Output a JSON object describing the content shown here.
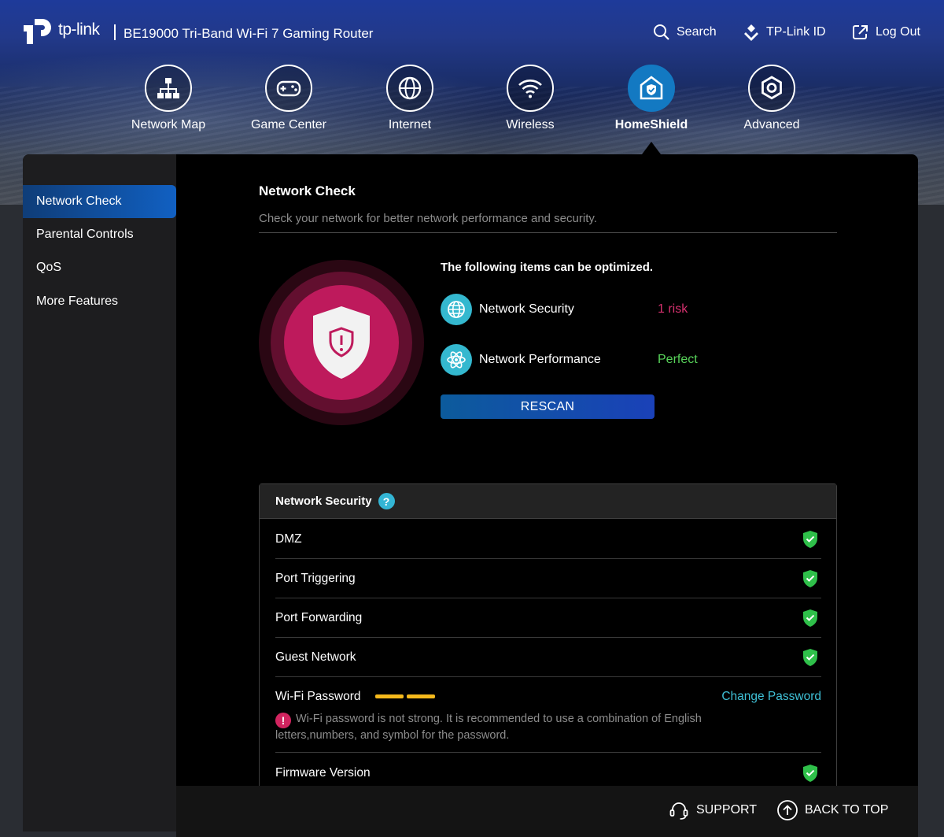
{
  "header": {
    "brand": "tp-link",
    "product": "BE19000 Tri-Band Wi-Fi 7 Gaming Router",
    "actions": {
      "search": "Search",
      "tplink_id": "TP-Link ID",
      "logout": "Log Out"
    }
  },
  "nav": {
    "items": [
      {
        "label": "Network Map",
        "icon": "network-map-icon"
      },
      {
        "label": "Game Center",
        "icon": "gamepad-icon"
      },
      {
        "label": "Internet",
        "icon": "globe-icon"
      },
      {
        "label": "Wireless",
        "icon": "wifi-icon"
      },
      {
        "label": "HomeShield",
        "icon": "homeshield-icon"
      },
      {
        "label": "Advanced",
        "icon": "gear-icon"
      }
    ],
    "active": "HomeShield"
  },
  "sidebar": {
    "items": [
      {
        "label": "Network Check"
      },
      {
        "label": "Parental Controls"
      },
      {
        "label": "QoS"
      },
      {
        "label": "More Features"
      }
    ],
    "active": "Network Check"
  },
  "main": {
    "title": "Network Check",
    "subtitle": "Check your network for better network performance and security.",
    "optimize_title": "The following items can be optimized.",
    "checks": [
      {
        "label": "Network Security",
        "status": "1 risk",
        "status_color": "#d6316f",
        "icon": "globe-icon"
      },
      {
        "label": "Network Performance",
        "status": "Perfect",
        "status_color": "#58d45a",
        "icon": "atom-icon"
      }
    ],
    "rescan_label": "RESCAN"
  },
  "security": {
    "title": "Network Security",
    "help": "?",
    "rows": [
      {
        "label": "DMZ",
        "state": "ok"
      },
      {
        "label": "Port Triggering",
        "state": "ok"
      },
      {
        "label": "Port Forwarding",
        "state": "ok"
      },
      {
        "label": "Guest Network",
        "state": "ok"
      }
    ],
    "wifi_password": {
      "label": "Wi-Fi Password",
      "strength_bars": 2,
      "action": "Change Password",
      "warning_icon": "!",
      "warning": "Wi-Fi password is not strong. It is recommended to use a combination of English letters,numbers, and symbol for the password."
    },
    "firmware": {
      "label": "Firmware Version",
      "state": "ok"
    }
  },
  "footer": {
    "support": "SUPPORT",
    "back_to_top": "BACK TO TOP"
  },
  "colors": {
    "accent": "#1379c2",
    "risk": "#d6316f",
    "ok": "#58d45a",
    "link": "#3fc0d6",
    "warning_bar": "#f5b91c"
  }
}
